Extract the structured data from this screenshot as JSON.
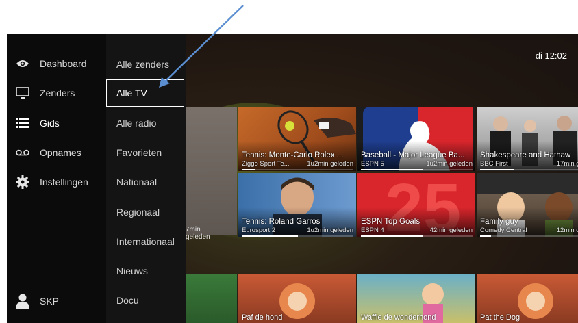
{
  "clock": "di 12:02",
  "sidebar": {
    "items": [
      {
        "label": "Dashboard",
        "icon": "eye-icon"
      },
      {
        "label": "Zenders",
        "icon": "monitor-icon"
      },
      {
        "label": "Gids",
        "icon": "list-icon"
      },
      {
        "label": "Opnames",
        "icon": "voicemail-icon"
      },
      {
        "label": "Instellingen",
        "icon": "gear-icon"
      }
    ],
    "profile": {
      "label": "SKP",
      "icon": "user-icon"
    }
  },
  "submenu": {
    "items": [
      {
        "label": "Alle zenders"
      },
      {
        "label": "Alle TV",
        "active": true
      },
      {
        "label": "Alle radio"
      },
      {
        "label": "Favorieten"
      },
      {
        "label": "Nationaal"
      },
      {
        "label": "Regionaal"
      },
      {
        "label": "Internationaal"
      },
      {
        "label": "Nieuws"
      },
      {
        "label": "Docu"
      }
    ]
  },
  "tiles": {
    "partial_ago": "7min geleden",
    "row1": [
      {
        "title": "Tennis: Monte-Carlo Rolex ...",
        "channel": "Ziggo Sport Te...",
        "ago": "1u2min geleden",
        "progress": 0.12
      },
      {
        "title": "Baseball - Major League Ba...",
        "channel": "ESPN 5",
        "ago": "1u2min geleden",
        "progress": 0.55
      },
      {
        "title": "Shakespeare and Hathaw",
        "channel": "BBC First",
        "ago": "17min gelec",
        "progress": 0.3
      }
    ],
    "row2": [
      {
        "title": "Tennis: Roland Garros",
        "channel": "Eurosport 2",
        "ago": "1u2min geleden",
        "progress": 0.5
      },
      {
        "title": "ESPN Top Goals",
        "channel": "ESPN 4",
        "ago": "42min geleden",
        "progress": 0.55
      },
      {
        "title": "Family guy",
        "channel": "Comedy Central",
        "ago": "12min gelec",
        "progress": 0.1
      }
    ],
    "row3": [
      {
        "title": "Paf de hond"
      },
      {
        "title": "Waffie de wonderhond"
      },
      {
        "title": "Pat the Dog"
      }
    ]
  },
  "colors": {
    "sidebar": "#0b0b0b",
    "submenu": "#141414",
    "arrow": "#5b8fd1",
    "espn_red": "#d9262c",
    "mlb_blue": "#1f3e8f"
  }
}
